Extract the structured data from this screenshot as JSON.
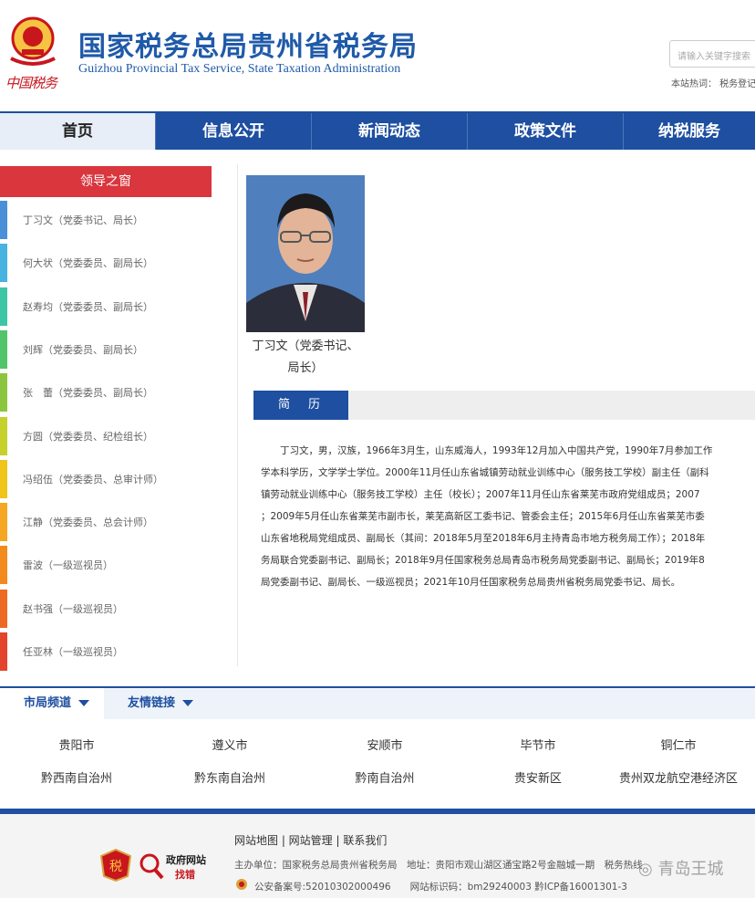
{
  "header": {
    "title": "国家税务总局贵州省税务局",
    "subtitle": "Guizhou Provincial Tax Service, State Taxation Administration",
    "brand_mark": "中国税务",
    "search_placeholder": "请输入关键字搜索",
    "hot_words": "本站热词：  税务登记"
  },
  "nav": {
    "items": [
      {
        "label": "首页",
        "active": true
      },
      {
        "label": "信息公开",
        "active": false
      },
      {
        "label": "新闻动态",
        "active": false
      },
      {
        "label": "政策文件",
        "active": false
      },
      {
        "label": "纳税服务",
        "active": false
      }
    ]
  },
  "sidebar": {
    "heading": "领导之窗",
    "leaders": [
      {
        "label": "丁习文（党委书记、局长）",
        "color": "#4a90d9"
      },
      {
        "label": "何大状（党委委员、副局长）",
        "color": "#46b3e0"
      },
      {
        "label": "赵寿均（党委委员、副局长）",
        "color": "#3cc6a5"
      },
      {
        "label": "刘辉（党委委员、副局长）",
        "color": "#52c46a"
      },
      {
        "label": "张　蕾（党委委员、副局长）",
        "color": "#8cc63f"
      },
      {
        "label": "方圆（党委委员、纪检组长）",
        "color": "#c6d12b"
      },
      {
        "label": "冯绍伍（党委委员、总审计师）",
        "color": "#f0c419"
      },
      {
        "label": "江静（党委委员、总会计师）",
        "color": "#f5a623"
      },
      {
        "label": "雷波（一级巡视员）",
        "color": "#f28a1e"
      },
      {
        "label": "赵书强（一级巡视员）",
        "color": "#ec6a22"
      },
      {
        "label": "任亚林（一级巡视员）",
        "color": "#e2452b"
      }
    ]
  },
  "profile": {
    "caption_line1": "丁习文（党委书记、",
    "caption_line2": "局长）",
    "resume_tab": "简历",
    "bio_lines": [
      "　　丁习文，男，汉族，1966年3月生，山东威海人，1993年12月加入中国共产党，1990年7月参加工作",
      "学本科学历，文学学士学位。2000年11月任山东省城镇劳动就业训练中心（服务技工学校）副主任（副科",
      "镇劳动就业训练中心（服务技工学校）主任（校长）；2007年11月任山东省莱芜市政府党组成员；2007",
      "；2009年5月任山东省莱芜市副市长，莱芜高新区工委书记、管委会主任；2015年6月任山东省莱芜市委",
      "山东省地税局党组成员、副局长（其间：2018年5月至2018年6月主持青岛市地方税务局工作）；2018年",
      "务局联合党委副书记、副局长；2018年9月任国家税务总局青岛市税务局党委副书记、副局长；2019年8",
      "局党委副书记、副局长、一级巡视员；2021年10月任国家税务总局贵州省税务局党委书记、局长。"
    ]
  },
  "channels": {
    "tabs": [
      {
        "label": "市局频道",
        "active": true
      },
      {
        "label": "友情链接",
        "active": false
      }
    ],
    "cities_row1": [
      "贵阳市",
      "遵义市",
      "安顺市",
      "毕节市",
      "铜仁市"
    ],
    "cities_row2": [
      "黔西南自治州",
      "黔东南自治州",
      "黔南自治州",
      "贵安新区",
      "贵州双龙航空港经济区"
    ]
  },
  "footer": {
    "links": "网站地图 | 网站管理 | 联系我们",
    "sponsor": "主办单位：国家税务总局贵州省税务局　地址：贵阳市观山湖区通宝路2号金融城一期　税务热线",
    "record": "公安备案号:52010302000496　　网站标识码：bm29240003 黔ICP备16001301-3",
    "badge_text": "政府网站",
    "badge_sub": "找错",
    "red_badge_text": "税",
    "watermark": "青岛王城"
  },
  "colors": {
    "primary_blue": "#1e4fa0",
    "accent_red": "#d9363e"
  }
}
